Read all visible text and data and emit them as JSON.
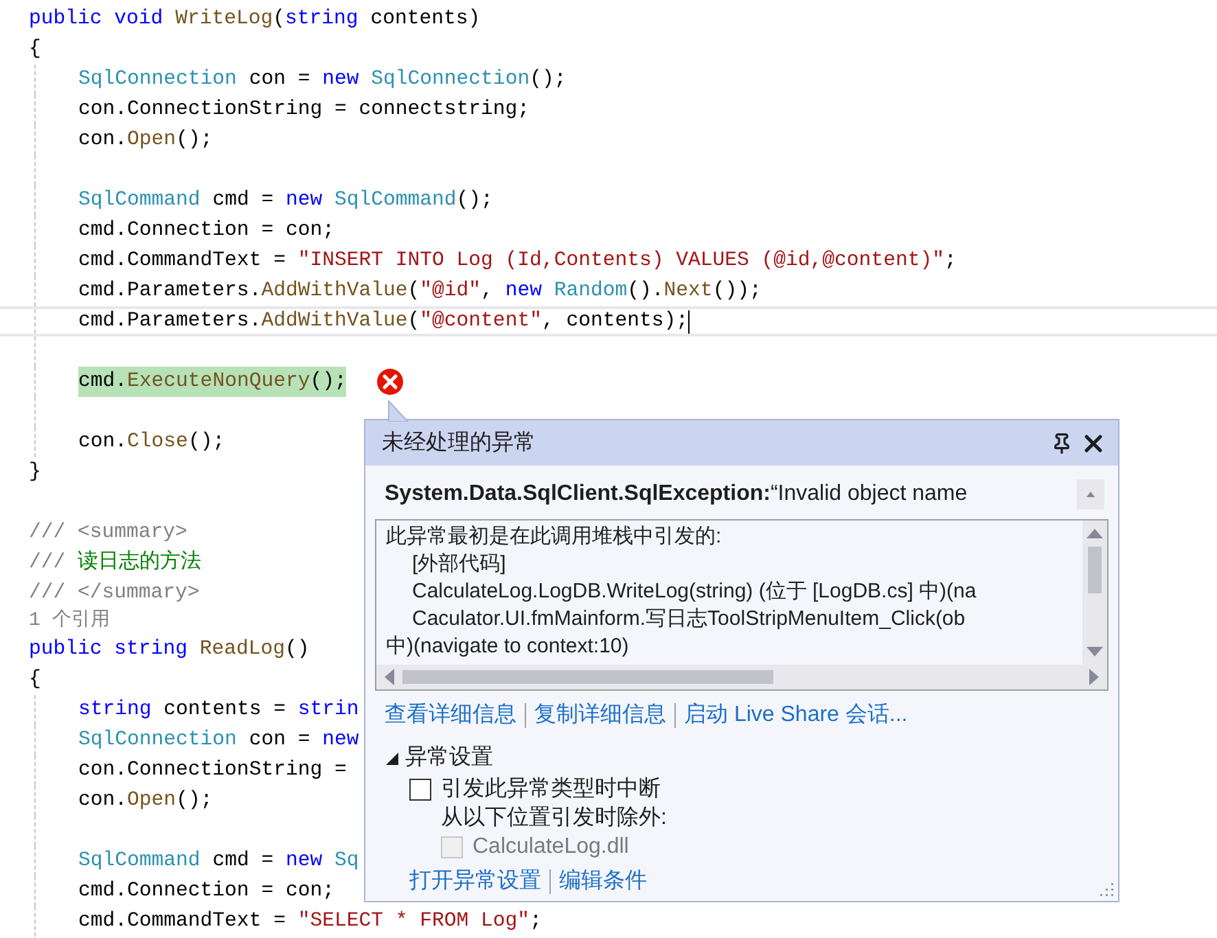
{
  "editor": {
    "lines": [
      {
        "kind": "code",
        "tokens": [
          {
            "t": "public ",
            "kind": "kw"
          },
          {
            "t": "void ",
            "kind": "kw"
          },
          {
            "t": "WriteLog",
            "kind": "method"
          },
          {
            "t": "(",
            "kind": "plain"
          },
          {
            "t": "string ",
            "kind": "kw"
          },
          {
            "t": "contents)",
            "kind": "plain"
          }
        ]
      },
      {
        "kind": "code",
        "tokens": [
          {
            "t": "{",
            "kind": "plain"
          }
        ]
      },
      {
        "kind": "code",
        "indented": true,
        "tokens": [
          {
            "t": "SqlConnection ",
            "kind": "type"
          },
          {
            "t": "con = ",
            "kind": "plain"
          },
          {
            "t": "new ",
            "kind": "kw"
          },
          {
            "t": "SqlConnection",
            "kind": "type"
          },
          {
            "t": "();",
            "kind": "plain"
          }
        ]
      },
      {
        "kind": "code",
        "indented": true,
        "tokens": [
          {
            "t": "con.ConnectionString = connectstring;",
            "kind": "plain"
          }
        ]
      },
      {
        "kind": "code",
        "indented": true,
        "tokens": [
          {
            "t": "con.",
            "kind": "plain"
          },
          {
            "t": "Open",
            "kind": "method"
          },
          {
            "t": "();",
            "kind": "plain"
          }
        ]
      },
      {
        "kind": "blank",
        "indented": true
      },
      {
        "kind": "code",
        "indented": true,
        "tokens": [
          {
            "t": "SqlCommand ",
            "kind": "type"
          },
          {
            "t": "cmd = ",
            "kind": "plain"
          },
          {
            "t": "new ",
            "kind": "kw"
          },
          {
            "t": "SqlCommand",
            "kind": "type"
          },
          {
            "t": "();",
            "kind": "plain"
          }
        ]
      },
      {
        "kind": "code",
        "indented": true,
        "tokens": [
          {
            "t": "cmd.Connection = con;",
            "kind": "plain"
          }
        ]
      },
      {
        "kind": "code",
        "indented": true,
        "tokens": [
          {
            "t": "cmd.CommandText = ",
            "kind": "plain"
          },
          {
            "t": "\"INSERT INTO Log (Id,Contents) VALUES (@id,@content)\"",
            "kind": "str"
          },
          {
            "t": ";",
            "kind": "plain"
          }
        ]
      },
      {
        "kind": "code",
        "indented": true,
        "tokens": [
          {
            "t": "cmd.Parameters.",
            "kind": "plain"
          },
          {
            "t": "AddWithValue",
            "kind": "method"
          },
          {
            "t": "(",
            "kind": "plain"
          },
          {
            "t": "\"@id\"",
            "kind": "str"
          },
          {
            "t": ", ",
            "kind": "plain"
          },
          {
            "t": "new ",
            "kind": "kw"
          },
          {
            "t": "Random",
            "kind": "type"
          },
          {
            "t": "().",
            "kind": "plain"
          },
          {
            "t": "Next",
            "kind": "method"
          },
          {
            "t": "());",
            "kind": "plain"
          }
        ]
      },
      {
        "kind": "current",
        "indented": true,
        "tokens": [
          {
            "t": "cmd.Parameters.",
            "kind": "plain"
          },
          {
            "t": "AddWithValue",
            "kind": "method"
          },
          {
            "t": "(",
            "kind": "plain"
          },
          {
            "t": "\"@content\"",
            "kind": "str"
          },
          {
            "t": ", contents);",
            "kind": "plain"
          }
        ]
      },
      {
        "kind": "blank",
        "indented": true
      },
      {
        "kind": "highlighted",
        "indented": true,
        "tokens": [
          {
            "t": "cmd.",
            "kind": "plain"
          },
          {
            "t": "ExecuteNonQuery",
            "kind": "method"
          },
          {
            "t": "();",
            "kind": "plain"
          }
        ]
      },
      {
        "kind": "blank",
        "indented": true
      },
      {
        "kind": "code",
        "indented": true,
        "tokens": [
          {
            "t": "con.",
            "kind": "plain"
          },
          {
            "t": "Close",
            "kind": "method"
          },
          {
            "t": "();",
            "kind": "plain"
          }
        ]
      },
      {
        "kind": "code",
        "tokens": [
          {
            "t": "}",
            "kind": "plain"
          }
        ]
      },
      {
        "kind": "blank"
      },
      {
        "kind": "code",
        "tokens": [
          {
            "t": "/// <summary>",
            "kind": "doc"
          }
        ]
      },
      {
        "kind": "code",
        "tokens": [
          {
            "t": "/// ",
            "kind": "doc"
          },
          {
            "t": "读日志的方法",
            "kind": "comment"
          }
        ]
      },
      {
        "kind": "code",
        "tokens": [
          {
            "t": "/// </summary>",
            "kind": "doc"
          }
        ]
      },
      {
        "kind": "codelens",
        "tokens": [
          {
            "t": "1 个引用",
            "kind": "doc"
          }
        ]
      },
      {
        "kind": "code",
        "tokens": [
          {
            "t": "public ",
            "kind": "kw"
          },
          {
            "t": "string ",
            "kind": "kw"
          },
          {
            "t": "ReadLog",
            "kind": "method"
          },
          {
            "t": "()",
            "kind": "plain"
          }
        ]
      },
      {
        "kind": "code",
        "tokens": [
          {
            "t": "{",
            "kind": "plain"
          }
        ]
      },
      {
        "kind": "code",
        "indented": true,
        "tokens": [
          {
            "t": "string ",
            "kind": "kw"
          },
          {
            "t": "contents = ",
            "kind": "plain"
          },
          {
            "t": "strin",
            "kind": "kw"
          }
        ]
      },
      {
        "kind": "code",
        "indented": true,
        "tokens": [
          {
            "t": "SqlConnection ",
            "kind": "type"
          },
          {
            "t": "con = ",
            "kind": "plain"
          },
          {
            "t": "new",
            "kind": "kw"
          }
        ]
      },
      {
        "kind": "code",
        "indented": true,
        "tokens": [
          {
            "t": "con.ConnectionString =",
            "kind": "plain"
          }
        ]
      },
      {
        "kind": "code",
        "indented": true,
        "tokens": [
          {
            "t": "con.",
            "kind": "plain"
          },
          {
            "t": "Open",
            "kind": "method"
          },
          {
            "t": "();",
            "kind": "plain"
          }
        ]
      },
      {
        "kind": "blank",
        "indented": true
      },
      {
        "kind": "code",
        "indented": true,
        "tokens": [
          {
            "t": "SqlCommand ",
            "kind": "type"
          },
          {
            "t": "cmd = ",
            "kind": "plain"
          },
          {
            "t": "new ",
            "kind": "kw"
          },
          {
            "t": "Sq",
            "kind": "type"
          }
        ]
      },
      {
        "kind": "code",
        "indented": true,
        "tokens": [
          {
            "t": "cmd.Connection = con;",
            "kind": "plain"
          }
        ]
      },
      {
        "kind": "code",
        "indented": true,
        "tokens": [
          {
            "t": "cmd.CommandText = ",
            "kind": "plain"
          },
          {
            "t": "\"SELECT * FROM Log\"",
            "kind": "str"
          },
          {
            "t": ";",
            "kind": "plain"
          }
        ]
      }
    ]
  },
  "exception_popup": {
    "title": "未经处理的异常",
    "exception_type": "System.Data.SqlClient.SqlException:",
    "message": "“Invalid object name",
    "stack_lines": [
      {
        "text": "此异常最初是在此调用堆栈中引发的:",
        "indented": false
      },
      {
        "text": "[外部代码]",
        "indented": true
      },
      {
        "text": "CalculateLog.LogDB.WriteLog(string) (位于 [LogDB.cs] 中)(na",
        "indented": true
      },
      {
        "text": "Caculator.UI.fmMainform.写日志ToolStripMenuItem_Click(ob",
        "indented": true
      },
      {
        "text": "中)(navigate to context:10)",
        "indented": false
      }
    ],
    "links": [
      "查看详细信息",
      "复制详细信息",
      "启动 Live Share 会话..."
    ],
    "settings": {
      "title": "异常设置",
      "expanded": true,
      "break_option": {
        "label": "引发此异常类型时中断",
        "checked": false
      },
      "except_label": "从以下位置引发时除外:",
      "modules": [
        {
          "label": "CalculateLog.dll",
          "checked": false,
          "disabled": true
        }
      ],
      "links": [
        "打开异常设置",
        "编辑条件"
      ]
    }
  }
}
